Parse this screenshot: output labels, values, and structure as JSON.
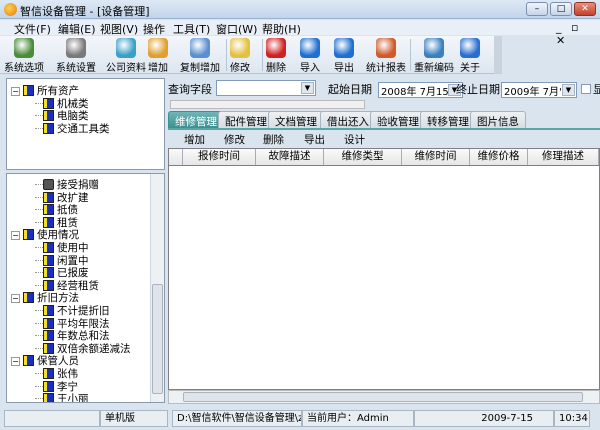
{
  "window": {
    "title": "智信设备管理 - [设备管理]",
    "minimize": "–",
    "maximize": "□",
    "close": "✕",
    "mdi_controls": "_ ▫ ✕"
  },
  "menu": [
    "文件(F)",
    "编辑(E)",
    "视图(V)",
    "操作",
    "工具(T)",
    "窗口(W)",
    "帮助(H)"
  ],
  "toolbar": [
    {
      "label": "系统选项",
      "icon": "system-options-icon",
      "color": "#4a8c3a"
    },
    {
      "label": "系统设置",
      "icon": "tools-icon",
      "color": "#7a7a7a"
    },
    {
      "label": "公司资料",
      "icon": "company-icon",
      "color": "#3aa0c8"
    },
    {
      "label": "增加",
      "icon": "add-user-icon",
      "color": "#e0a030"
    },
    {
      "label": "复制增加",
      "icon": "copy-add-icon",
      "color": "#5a8fd0"
    },
    {
      "label": "修改",
      "icon": "edit-icon",
      "color": "#e2c040"
    },
    {
      "label": "删除",
      "icon": "delete-icon",
      "color": "#d02020"
    },
    {
      "label": "导入",
      "icon": "import-icon",
      "color": "#1f6fd0"
    },
    {
      "label": "导出",
      "icon": "export-icon",
      "color": "#1f6fd0"
    },
    {
      "label": "统计报表",
      "icon": "chart-report-icon",
      "color": "#d05a2a"
    },
    {
      "label": "重新编码",
      "icon": "recode-icon",
      "color": "#3a7fc0"
    },
    {
      "label": "关于",
      "icon": "help-icon",
      "color": "#2a6fd0"
    }
  ],
  "tree_top": [
    {
      "label": "所有资产",
      "level": 0,
      "expanded": true
    },
    {
      "label": "机械类",
      "level": 1
    },
    {
      "label": "电脑类",
      "level": 1
    },
    {
      "label": "交通工具类",
      "level": 1
    }
  ],
  "tree_bottom": [
    {
      "label": "接受捐赠",
      "level": 1,
      "icon": "book"
    },
    {
      "label": "改扩建",
      "level": 1
    },
    {
      "label": "抵债",
      "level": 1
    },
    {
      "label": "租赁",
      "level": 1
    },
    {
      "label": "使用情况",
      "level": 0,
      "expanded": true
    },
    {
      "label": "使用中",
      "level": 1
    },
    {
      "label": "闲置中",
      "level": 1
    },
    {
      "label": "已报废",
      "level": 1
    },
    {
      "label": "经营租赁",
      "level": 1
    },
    {
      "label": "折旧方法",
      "level": 0,
      "expanded": true
    },
    {
      "label": "不计提折旧",
      "level": 1
    },
    {
      "label": "平均年限法",
      "level": 1
    },
    {
      "label": "年数总和法",
      "level": 1
    },
    {
      "label": "双倍余额递减法",
      "level": 1
    },
    {
      "label": "保管人员",
      "level": 0,
      "expanded": true
    },
    {
      "label": "张伟",
      "level": 1
    },
    {
      "label": "李宁",
      "level": 1
    },
    {
      "label": "王小丽",
      "level": 1
    }
  ],
  "query": {
    "field_label": "查询字段",
    "field_value": "",
    "start_label": "起始日期",
    "start_value": "2008年 7月15",
    "end_label": "终止日期",
    "end_value": "2009年 7月'",
    "checkbox_label": "显",
    "checked": false
  },
  "tabs": [
    {
      "label": "维修管理",
      "active": true
    },
    {
      "label": "配件管理"
    },
    {
      "label": "文档管理"
    },
    {
      "label": "借出还入"
    },
    {
      "label": "验收管理"
    },
    {
      "label": "转移管理"
    },
    {
      "label": "图片信息"
    }
  ],
  "subtoolbar": [
    "增加",
    "修改",
    "删除",
    "导出",
    "设计"
  ],
  "grid": {
    "columns": [
      "报修时间",
      "故障描述",
      "维修类型",
      "维修时间",
      "维修价格",
      "修理描述"
    ],
    "rows": []
  },
  "status": {
    "mode": "单机版",
    "path": "D:\\智信软件\\智信设备管理\\zxSBData.sys",
    "user": "当前用户：Admin",
    "date": "2009-7-15",
    "time": "10:34"
  }
}
